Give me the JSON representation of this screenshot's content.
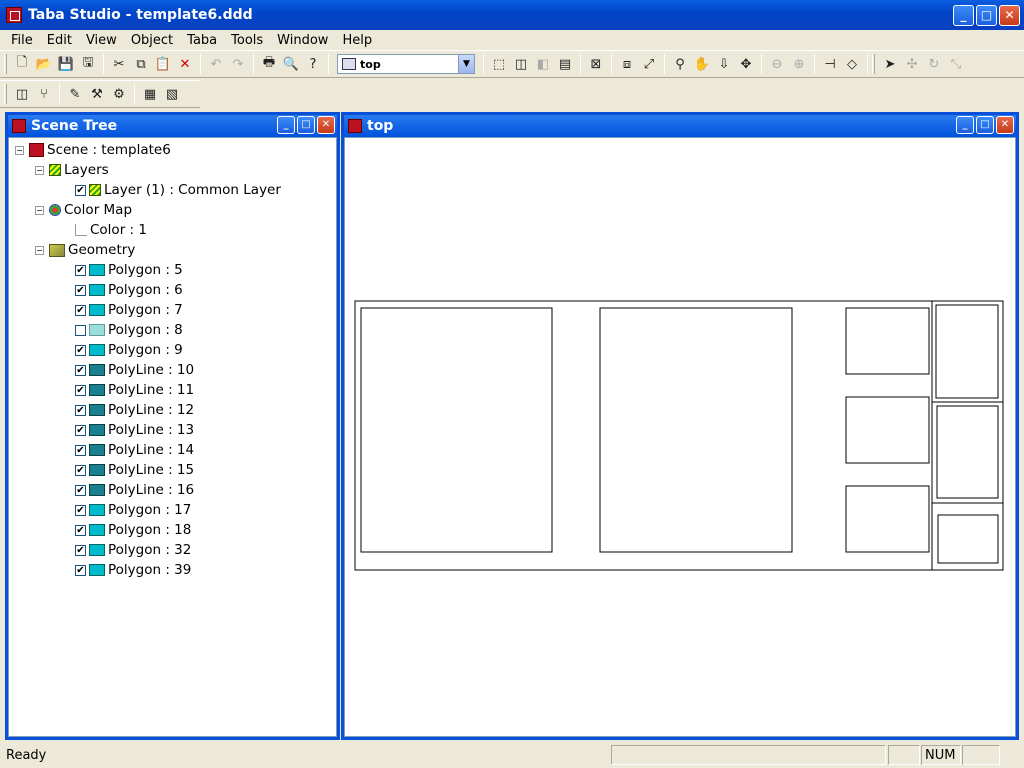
{
  "window": {
    "title": "Taba Studio - template6.ddd",
    "min": "_",
    "max": "□",
    "close": "✕"
  },
  "menu": [
    "File",
    "Edit",
    "View",
    "Object",
    "Taba",
    "Tools",
    "Window",
    "Help"
  ],
  "toolbar": {
    "view_combo": "top"
  },
  "scene_tree": {
    "title": "Scene Tree",
    "root": "Scene : template6",
    "layers_label": "Layers",
    "layer_item": "Layer (1) : Common Layer",
    "colormap_label": "Color Map",
    "color_item": "Color : 1",
    "geometry_label": "Geometry",
    "items": [
      {
        "label": "Polygon : 5",
        "checked": true,
        "kind": "poly"
      },
      {
        "label": "Polygon : 6",
        "checked": true,
        "kind": "poly"
      },
      {
        "label": "Polygon : 7",
        "checked": true,
        "kind": "poly"
      },
      {
        "label": "Polygon : 8",
        "checked": false,
        "kind": "poly"
      },
      {
        "label": "Polygon : 9",
        "checked": true,
        "kind": "poly"
      },
      {
        "label": "PolyLine : 10",
        "checked": true,
        "kind": "line"
      },
      {
        "label": "PolyLine : 11",
        "checked": true,
        "kind": "line"
      },
      {
        "label": "PolyLine : 12",
        "checked": true,
        "kind": "line"
      },
      {
        "label": "PolyLine : 13",
        "checked": true,
        "kind": "line"
      },
      {
        "label": "PolyLine : 14",
        "checked": true,
        "kind": "line"
      },
      {
        "label": "PolyLine : 15",
        "checked": true,
        "kind": "line"
      },
      {
        "label": "PolyLine : 16",
        "checked": true,
        "kind": "line"
      },
      {
        "label": "Polygon : 17",
        "checked": true,
        "kind": "poly"
      },
      {
        "label": "Polygon : 18",
        "checked": true,
        "kind": "poly"
      },
      {
        "label": "Polygon : 32",
        "checked": true,
        "kind": "poly"
      },
      {
        "label": "Polygon : 39",
        "checked": true,
        "kind": "poly"
      }
    ]
  },
  "view_panel": {
    "title": "top"
  },
  "status": {
    "text": "Ready",
    "num": "NUM"
  }
}
